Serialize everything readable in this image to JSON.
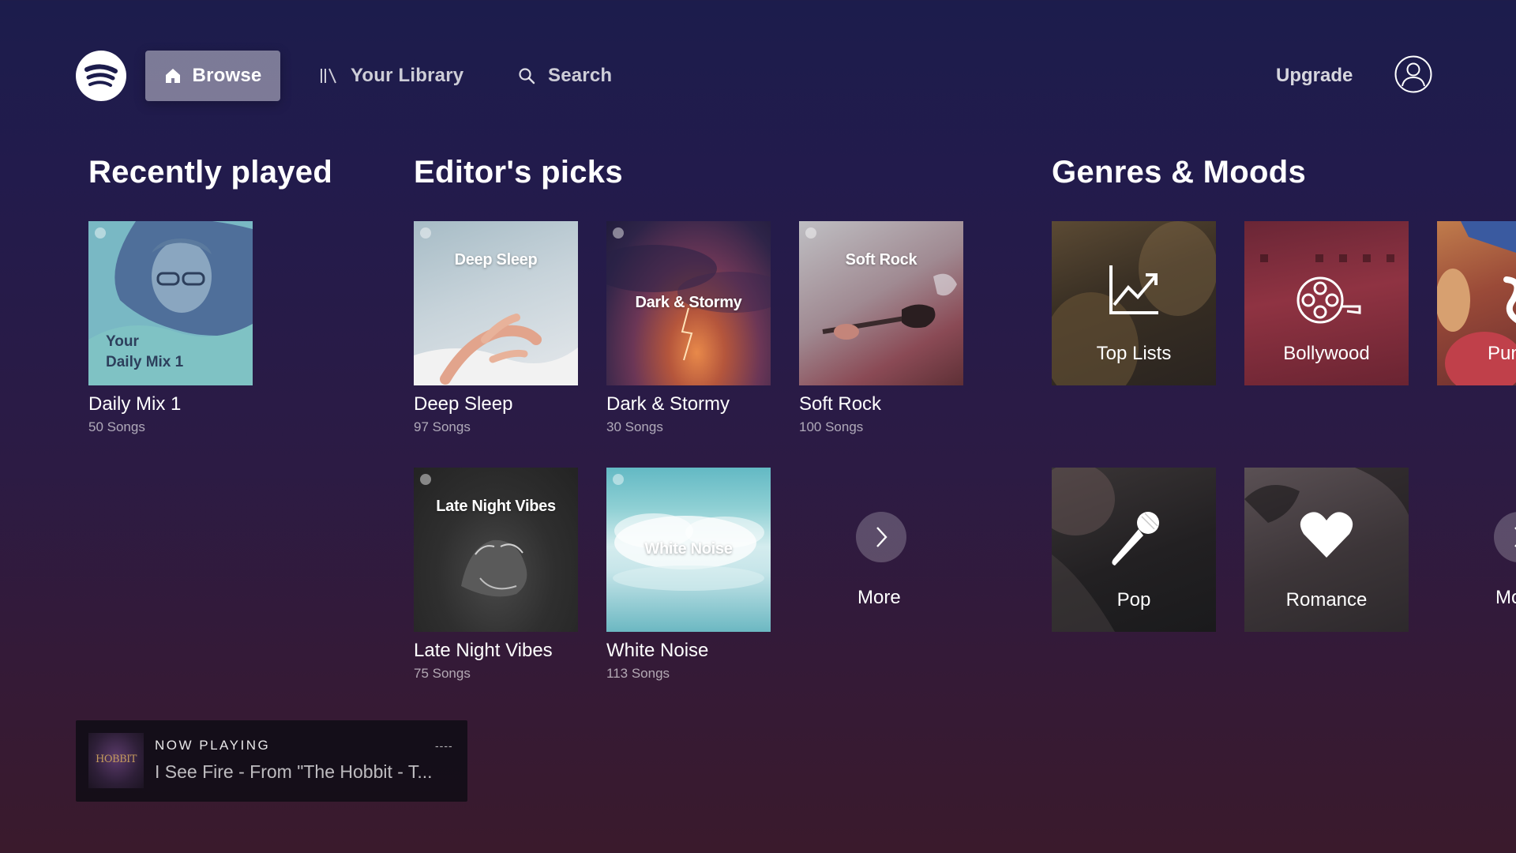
{
  "nav": {
    "browse_label": "Browse",
    "library_label": "Your Library",
    "search_label": "Search",
    "upgrade_label": "Upgrade"
  },
  "sections": {
    "recently_played": "Recently played",
    "editors_picks": "Editor's picks",
    "genres_moods": "Genres & Moods"
  },
  "recently_played": [
    {
      "tile_text_line1": "Your",
      "tile_text_line2": "Daily Mix 1",
      "title": "Daily Mix 1",
      "subtitle": "50 Songs"
    }
  ],
  "editors_picks": [
    {
      "tile_text": "Deep Sleep",
      "title": "Deep Sleep",
      "subtitle": "97 Songs"
    },
    {
      "tile_text": "Dark & Stormy",
      "title": "Dark & Stormy",
      "subtitle": "30 Songs"
    },
    {
      "tile_text": "Soft Rock",
      "title": "Soft Rock",
      "subtitle": "100 Songs"
    },
    {
      "tile_text": "Late Night Vibes",
      "title": "Late Night Vibes",
      "subtitle": "75 Songs"
    },
    {
      "tile_text": "White Noise",
      "title": "White Noise",
      "subtitle": "113 Songs"
    }
  ],
  "editors_more_label": "More",
  "genres": [
    {
      "label": "Top Lists",
      "icon": "chart-icon"
    },
    {
      "label": "Bollywood",
      "icon": "film-reel-icon"
    },
    {
      "label": "Pun",
      "icon": "letter-icon"
    },
    {
      "label": "Pop",
      "icon": "microphone-icon"
    },
    {
      "label": "Romance",
      "icon": "heart-icon"
    }
  ],
  "genres_more_label": "Mo",
  "now_playing": {
    "label": "NOW PLAYING",
    "track": "I See Fire - From \"The Hobbit - T...",
    "art_text": "HOBBIT",
    "dots": "----"
  },
  "colors": {
    "background_top": "#1c1c4c",
    "background_bottom": "#3a1a2c",
    "browse_highlight": "#6e6a8e"
  }
}
